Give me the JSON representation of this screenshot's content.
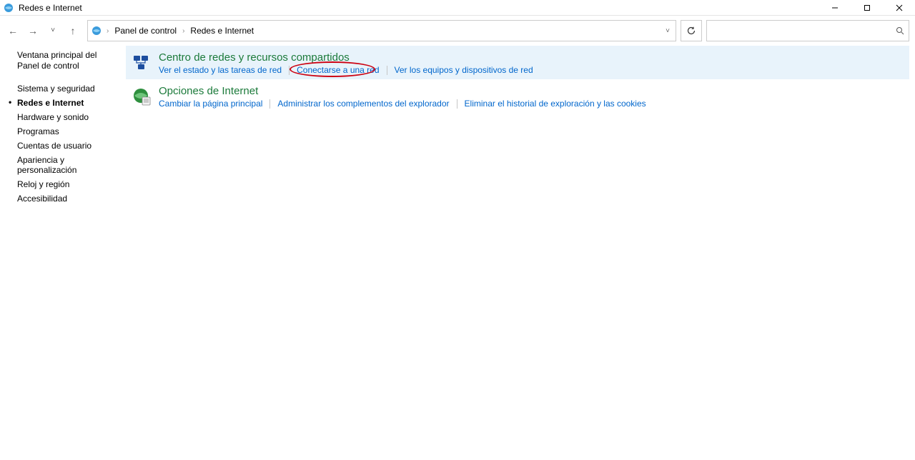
{
  "window": {
    "title": "Redes e Internet"
  },
  "breadcrumb": {
    "root": "Panel de control",
    "current": "Redes e Internet"
  },
  "search": {
    "placeholder": ""
  },
  "sidebar": {
    "home": "Ventana principal del Panel de control",
    "items": [
      {
        "label": "Sistema y seguridad",
        "active": false
      },
      {
        "label": "Redes e Internet",
        "active": true
      },
      {
        "label": "Hardware y sonido",
        "active": false
      },
      {
        "label": "Programas",
        "active": false
      },
      {
        "label": "Cuentas de usuario",
        "active": false
      },
      {
        "label": "Apariencia y personalización",
        "active": false
      },
      {
        "label": "Reloj y región",
        "active": false
      },
      {
        "label": "Accesibilidad",
        "active": false
      }
    ]
  },
  "categories": {
    "network": {
      "title": "Centro de redes y recursos compartidos",
      "links": {
        "status": "Ver el estado y las tareas de red",
        "connect": "Conectarse a una red",
        "devices": "Ver los equipos y dispositivos de red"
      }
    },
    "internet": {
      "title": "Opciones de Internet",
      "links": {
        "homepage": "Cambiar la página principal",
        "addons": "Administrar los complementos del explorador",
        "clear": "Eliminar el historial de exploración y las cookies"
      }
    }
  }
}
